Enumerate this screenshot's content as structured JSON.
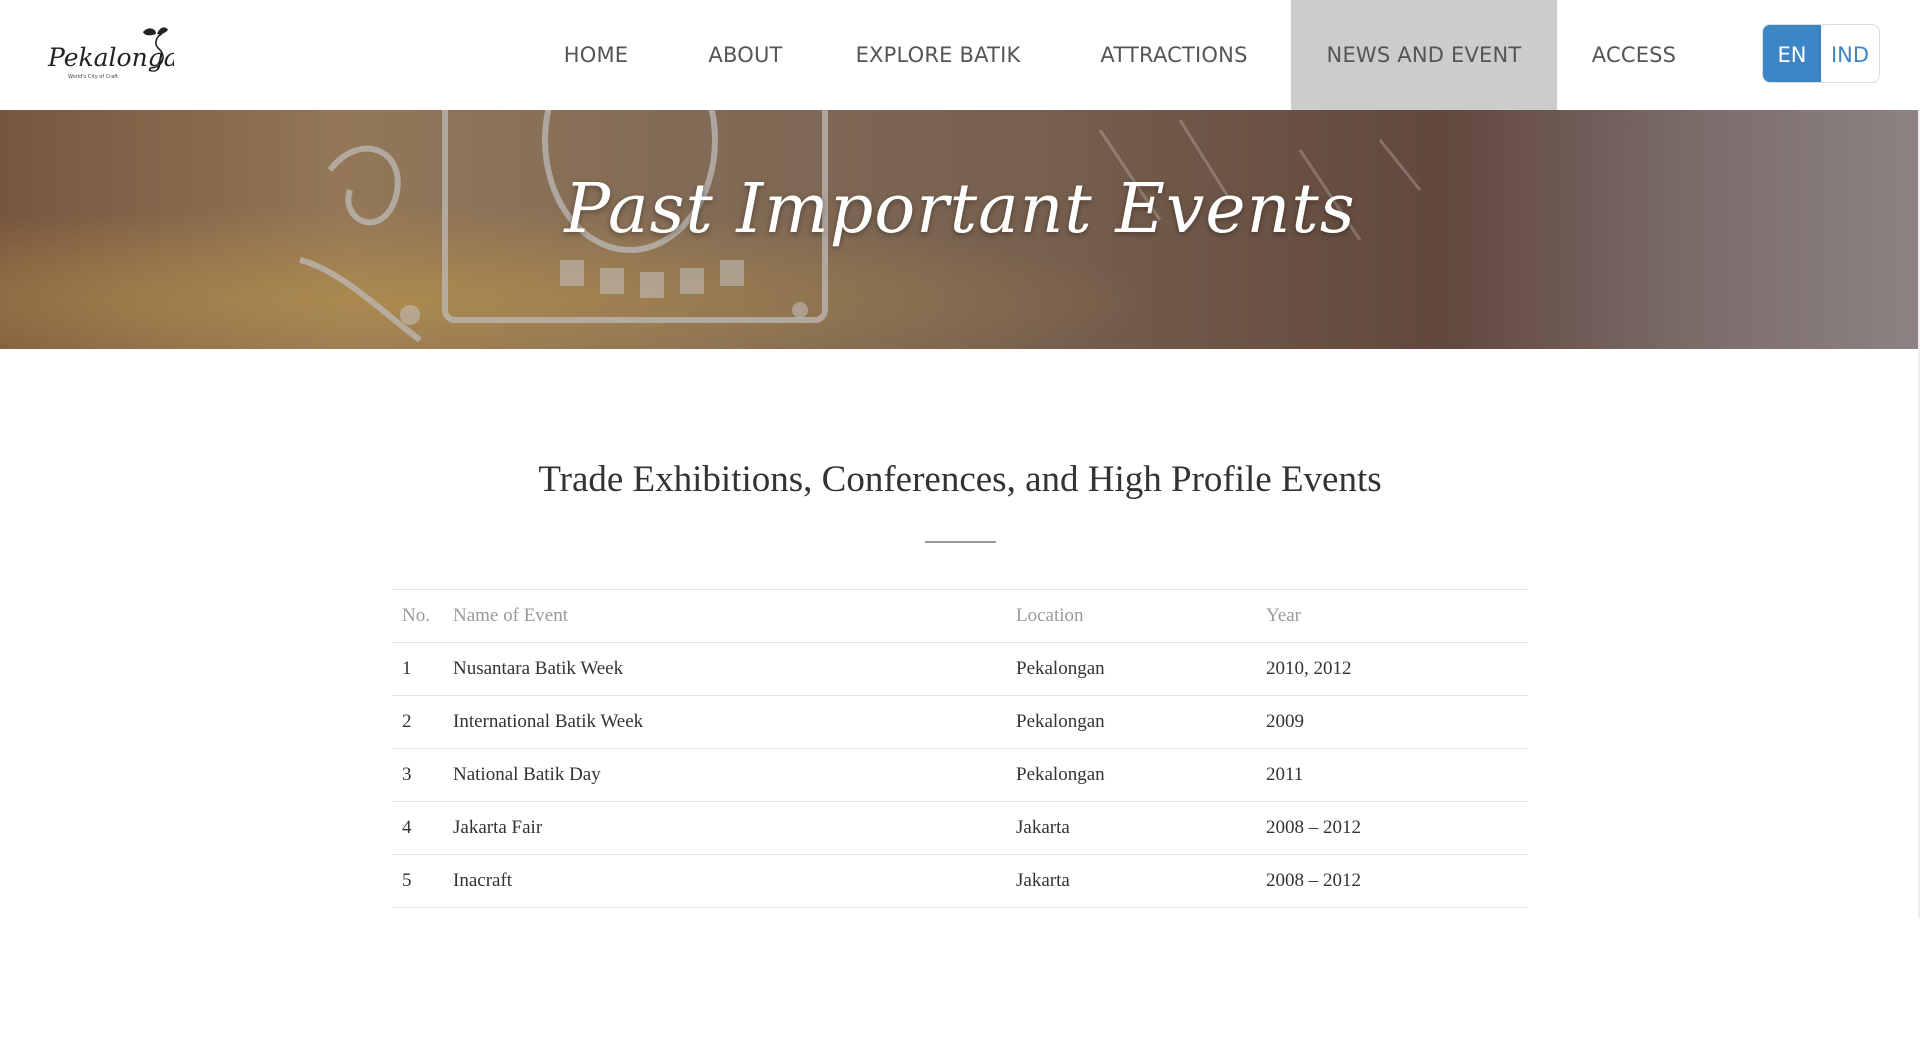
{
  "header": {
    "logo_text": "Pekalongan",
    "logo_tagline": "World's City of Craft",
    "nav": [
      {
        "label": "HOME",
        "active": false
      },
      {
        "label": "ABOUT",
        "active": false
      },
      {
        "label": "EXPLORE BATIK",
        "active": false
      },
      {
        "label": "ATTRACTIONS",
        "active": false
      },
      {
        "label": "NEWS AND EVENT",
        "active": true
      },
      {
        "label": "ACCESS",
        "active": false
      }
    ],
    "lang": {
      "en": "EN",
      "ind": "IND"
    }
  },
  "banner": {
    "title": "Past Important Events"
  },
  "section": {
    "heading": "Trade Exhibitions, Conferences, and High Profile Events"
  },
  "table": {
    "headers": [
      "No.",
      "Name of Event",
      "Location",
      "Year"
    ],
    "rows": [
      [
        "1",
        "Nusantara Batik Week",
        "Pekalongan",
        "2010, 2012"
      ],
      [
        "2",
        "International Batik Week",
        "Pekalongan",
        "2009"
      ],
      [
        "3",
        "National Batik Day",
        "Pekalongan",
        "2011"
      ],
      [
        "4",
        "Jakarta Fair",
        "Jakarta",
        "2008 – 2012"
      ],
      [
        "5",
        "Inacraft",
        "Jakarta",
        "2008 – 2012"
      ]
    ]
  },
  "colors": {
    "accent": "#3d86c6",
    "nav_active_bg": "#cccccc",
    "nav_text": "#555555"
  }
}
